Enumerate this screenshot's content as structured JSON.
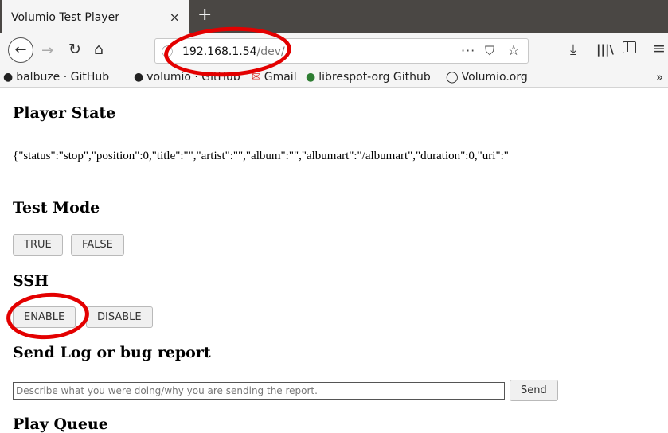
{
  "tab": {
    "title": "Volumio Test Player",
    "close_glyph": "×"
  },
  "new_tab_glyph": "+",
  "nav": {
    "url_host": "192.168.1.54",
    "url_path": "/dev/",
    "page_actions_glyph": "···",
    "icons": [
      "back-icon",
      "forward-icon",
      "reload-icon",
      "home-icon",
      "info-icon",
      "pocket-icon",
      "star-icon",
      "download-icon",
      "library-icon",
      "sidebar-icon",
      "menu-icon"
    ]
  },
  "bookmarks": {
    "items": [
      {
        "label": "balbuze · GitHub",
        "icon": "github-icon"
      },
      {
        "label": "volumio · GitHub",
        "icon": "github-icon"
      },
      {
        "label": "Gmail",
        "icon": "gmail-icon"
      },
      {
        "label": "librespot-org Github",
        "icon": "github-icon"
      },
      {
        "label": "Volumio.org",
        "icon": "volumio-icon"
      }
    ],
    "overflow_glyph": "»"
  },
  "page": {
    "player_state_heading": "Player State",
    "player_state_json": "{\"status\":\"stop\",\"position\":0,\"title\":\"\",\"artist\":\"\",\"album\":\"\",\"albumart\":\"/albumart\",\"duration\":0,\"uri\":\"",
    "test_mode_heading": "Test Mode",
    "test_mode_true": "TRUE",
    "test_mode_false": "FALSE",
    "ssh_heading": "SSH",
    "ssh_enable": "ENABLE",
    "ssh_disable": "DISABLE",
    "report_heading": "Send Log or bug report",
    "report_placeholder": "Describe what you were doing/why you are sending the report.",
    "report_send": "Send",
    "queue_heading": "Play Queue"
  },
  "colors": {
    "annotation": "#e30000",
    "tabstrip": "#4a4744",
    "toolbar": "#f5f5f5"
  }
}
